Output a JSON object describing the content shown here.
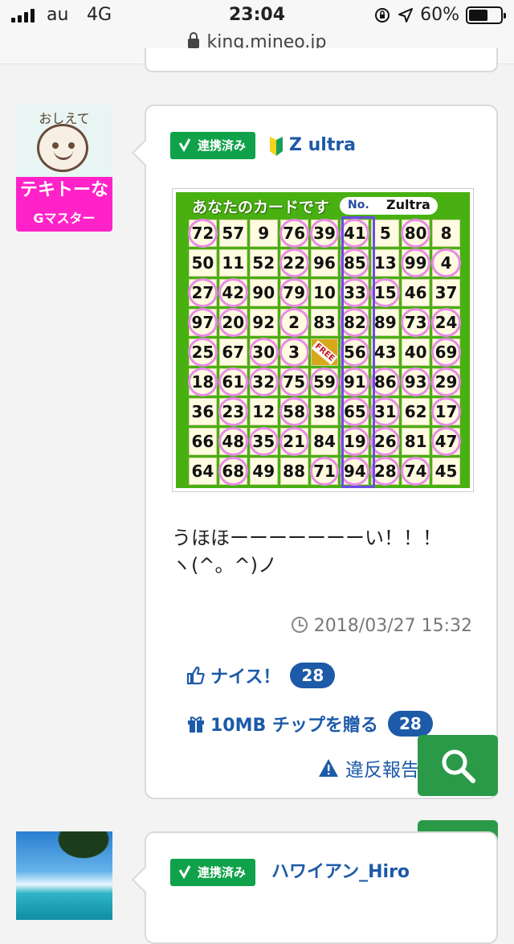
{
  "status_bar": {
    "carrier": "au",
    "network": "4G",
    "time": "23:04",
    "battery": "60%",
    "battery_level": 0.6
  },
  "browser": {
    "url": "king.mineo.jp"
  },
  "post": {
    "avatar": {
      "caption": "おしえて",
      "role": "テキトーな",
      "rank": "Gマスター"
    },
    "linked_badge": "連携済み",
    "username": "Z ultra",
    "bingo": {
      "title": "あなたのカードです",
      "no_label": "No.",
      "name": "Zultra",
      "free_label": "FREE",
      "rows": [
        [
          "72",
          "57",
          "9",
          "76",
          "39",
          "41",
          "5",
          "80",
          "8"
        ],
        [
          "50",
          "11",
          "52",
          "22",
          "96",
          "85",
          "13",
          "99",
          "4"
        ],
        [
          "27",
          "42",
          "90",
          "79",
          "10",
          "33",
          "15",
          "46",
          "37"
        ],
        [
          "97",
          "20",
          "92",
          "2",
          "83",
          "82",
          "89",
          "73",
          "24"
        ],
        [
          "25",
          "67",
          "30",
          "3",
          "FREE",
          "56",
          "43",
          "40",
          "69"
        ],
        [
          "18",
          "61",
          "32",
          "75",
          "59",
          "91",
          "86",
          "93",
          "29"
        ],
        [
          "36",
          "23",
          "12",
          "58",
          "38",
          "65",
          "31",
          "62",
          "17"
        ],
        [
          "66",
          "48",
          "35",
          "21",
          "84",
          "19",
          "26",
          "81",
          "47"
        ],
        [
          "64",
          "68",
          "49",
          "88",
          "71",
          "94",
          "28",
          "74",
          "45"
        ]
      ],
      "hits": [
        [
          1,
          0,
          0,
          1,
          1,
          1,
          0,
          1,
          0
        ],
        [
          0,
          0,
          0,
          1,
          0,
          1,
          0,
          1,
          1
        ],
        [
          1,
          1,
          0,
          1,
          0,
          1,
          1,
          0,
          0
        ],
        [
          1,
          1,
          0,
          1,
          0,
          1,
          0,
          1,
          1
        ],
        [
          1,
          0,
          1,
          1,
          0,
          1,
          0,
          0,
          1
        ],
        [
          1,
          1,
          1,
          1,
          1,
          1,
          1,
          1,
          1
        ],
        [
          0,
          1,
          0,
          1,
          0,
          1,
          1,
          0,
          1
        ],
        [
          0,
          1,
          1,
          1,
          0,
          1,
          1,
          0,
          1
        ],
        [
          0,
          1,
          0,
          0,
          1,
          1,
          1,
          1,
          0
        ]
      ]
    },
    "body_line1": "うほほーーーーーーーい！！！",
    "body_line2": "ヽ(^。^)ノ",
    "timestamp": "2018/03/27 15:32",
    "nice_label": "ナイス！",
    "nice_count": "28",
    "chip_label": "10MB チップを贈る",
    "chip_count": "28",
    "report_label": "違反報告する"
  },
  "next_post": {
    "linked_badge": "連携済み",
    "username": "ハワイアン_Hiro"
  },
  "colors": {
    "accent_blue": "#1d5aa8",
    "linked_green": "#10a24a",
    "fab_green": "#2b9a48",
    "role_pink": "#ff22c8"
  },
  "icons": [
    "search-icon",
    "arrow-up-icon",
    "thumb-up-icon",
    "gift-icon",
    "warning-icon",
    "clock-icon",
    "lock-icon",
    "beginner-mark-icon"
  ]
}
